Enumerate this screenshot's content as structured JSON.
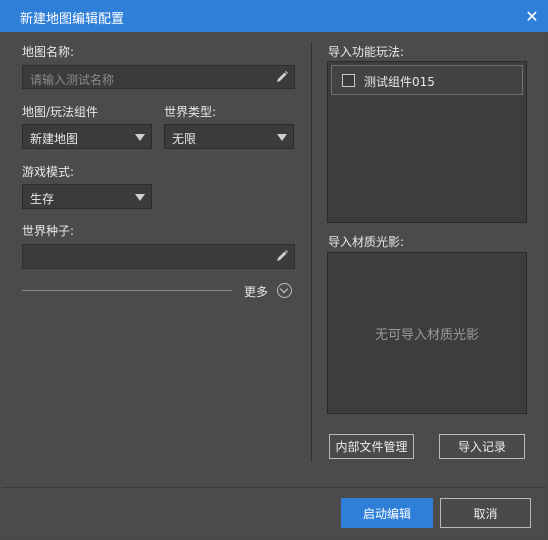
{
  "window": {
    "title": "新建地图编辑配置",
    "close_icon": "close-icon",
    "accent_color": "#2f7fd8"
  },
  "left": {
    "map_name": {
      "label": "地图名称:",
      "placeholder": "请输入测试名称",
      "value": "",
      "icon": "pencil-icon"
    },
    "map_component": {
      "label": "地图/玩法组件",
      "value": "新建地图"
    },
    "world_type": {
      "label": "世界类型:",
      "value": "无限"
    },
    "game_mode": {
      "label": "游戏模式:",
      "value": "生存"
    },
    "world_seed": {
      "label": "世界种子:",
      "value": "",
      "icon": "pencil-icon"
    },
    "more": {
      "label": "更多",
      "icon": "chevron-down-circle-icon"
    }
  },
  "right": {
    "import_gameplay": {
      "label": "导入功能玩法:",
      "items": [
        {
          "label": "测试组件015",
          "checked": false
        }
      ]
    },
    "import_shader": {
      "label": "导入材质光影:",
      "empty_text": "无可导入材质光影"
    },
    "buttons": {
      "internal_files": "内部文件管理",
      "import_log": "导入记录"
    }
  },
  "footer": {
    "start_edit": "启动编辑",
    "cancel": "取消"
  }
}
